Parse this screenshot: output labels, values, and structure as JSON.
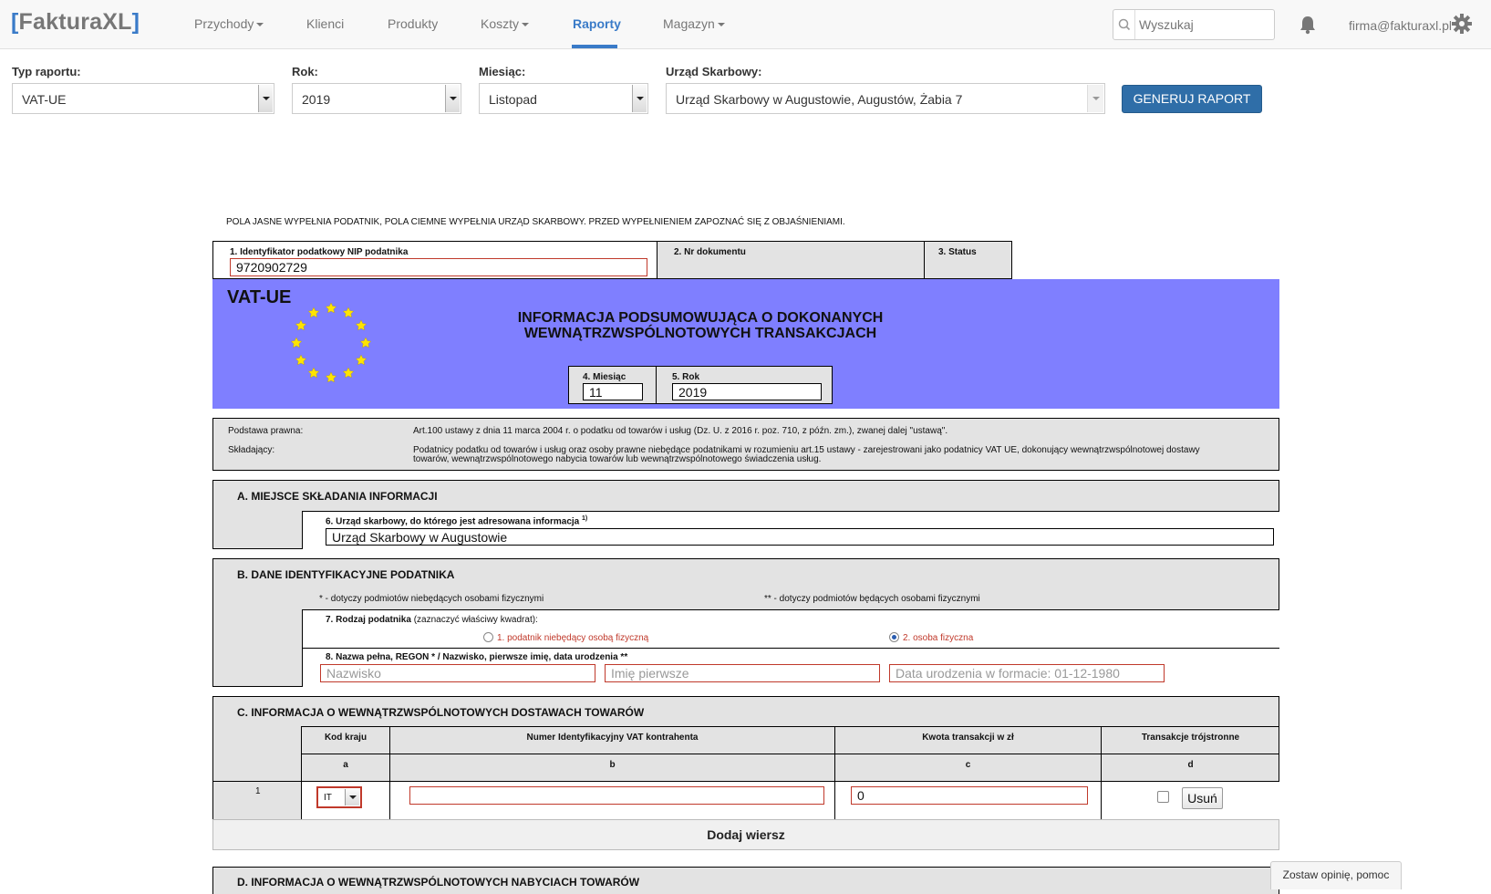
{
  "navbar": {
    "brand_open": "[",
    "brand_name": "FakturaXL",
    "brand_close": "]",
    "items": [
      {
        "label": "Przychody",
        "dropdown": true
      },
      {
        "label": "Klienci",
        "dropdown": false
      },
      {
        "label": "Produkty",
        "dropdown": false
      },
      {
        "label": "Koszty",
        "dropdown": true
      },
      {
        "label": "Raporty",
        "dropdown": false,
        "active": true
      },
      {
        "label": "Magazyn",
        "dropdown": true
      }
    ],
    "search_placeholder": "Wyszukaj",
    "user_email": "firma@fakturaxl.pl"
  },
  "filters": {
    "report_type_label": "Typ raportu:",
    "report_type_value": "VAT-UE",
    "year_label": "Rok:",
    "year_value": "2019",
    "month_label": "Miesiąc:",
    "month_value": "Listopad",
    "tax_office_label": "Urząd Skarbowy:",
    "tax_office_value": "Urząd Skarbowy w Augustowie, Augustów, Żabia 7",
    "generate_button": "GENERUJ RAPORT"
  },
  "form": {
    "notice": "POLA JASNE WYPEŁNIA PODATNIK, POLA CIEMNE WYPEŁNIA URZĄD SKARBOWY. PRZED WYPEŁNIENIEM ZAPOZNAĆ SIĘ Z OBJAŚNIENIAMI.",
    "nip_label": "1. Identyfikator podatkowy NIP podatnika",
    "nip_value": "9720902729",
    "doc_no_label": "2. Nr dokumentu",
    "status_label": "3. Status",
    "form_code": "VAT-UE",
    "title_line1": "INFORMACJA PODSUMOWUJĄCA O DOKONANYCH",
    "title_line2": "WEWNĄTRZWSPÓLNOTOWYCH TRANSAKCJACH",
    "month_label": "4. Miesiąc",
    "month_value": "11",
    "year_label": "5. Rok",
    "year_value": "2019",
    "legal_basis_label": "Podstawa prawna:",
    "legal_basis_text": "Art.100 ustawy z dnia 11 marca 2004 r. o podatku od towarów i usług (Dz. U. z 2016 r. poz. 710, z późn. zm.), zwanej dalej \"ustawą\".",
    "filer_label": "Składający:",
    "filer_text_line1": "Podatnicy podatku od towarów i usług oraz osoby prawne niebędące podatnikami w rozumieniu art.15 ustawy - zarejestrowani jako podatnicy VAT UE, dokonujący wewnątrzwspólnotowej dostawy",
    "filer_text_line2": "towarów, wewnątrzwspólnotowego nabycia towarów lub wewnątrzwspólnotowego świadczenia usług.",
    "section_a_title": "A. MIEJSCE SKŁADANIA INFORMACJI",
    "office_field_label": "6. Urząd skarbowy, do którego jest adresowana informacja",
    "office_field_sup": "1)",
    "office_field_value": "Urząd Skarbowy w Augustowie",
    "section_b_title": "B. DANE IDENTYFIKACYJNE PODATNIKA",
    "note_non_natural": "* - dotyczy podmiotów niebędących osobami fizycznymi",
    "note_natural": "** - dotyczy podmiotów będących osobami fizycznymi",
    "taxpayer_type_label": "7. Rodzaj podatnika",
    "taxpayer_type_hint": "(zaznaczyć właściwy kwadrat):",
    "taxpayer_option1": "1. podatnik niebędący osobą fizyczną",
    "taxpayer_option2": "2. osoba fizyczna",
    "taxpayer_selected": 2,
    "name_field_label": "8. Nazwa pełna, REGON * / Nazwisko, pierwsze imię, data urodzenia **",
    "surname_placeholder": "Nazwisko",
    "firstname_placeholder": "Imię pierwsze",
    "birthdate_placeholder": "Data urodzenia w formacie: 01-12-1980",
    "section_c_title": "C. INFORMACJA O WEWNĄTRZWSPÓLNOTOWYCH DOSTAWACH TOWARÓW",
    "columns": [
      {
        "label": "Kod kraju",
        "letter": "a"
      },
      {
        "label": "Numer Identyfikacyjny VAT kontrahenta",
        "letter": "b"
      },
      {
        "label": "Kwota transakcji w zł",
        "letter": "c"
      },
      {
        "label": "Transakcje trójstronne",
        "letter": "d"
      }
    ],
    "row_number": "1",
    "row_country": "IT",
    "row_vat_no": "",
    "row_amount": "0",
    "row_remove_button": "Usuń",
    "add_row_button": "Dodaj wiersz",
    "section_d_title": "D. INFORMACJA O WEWNĄTRZWSPÓLNOTOWYCH NABYCIACH TOWARÓW"
  },
  "feedback_button": "Zostaw opinię, pomoc"
}
